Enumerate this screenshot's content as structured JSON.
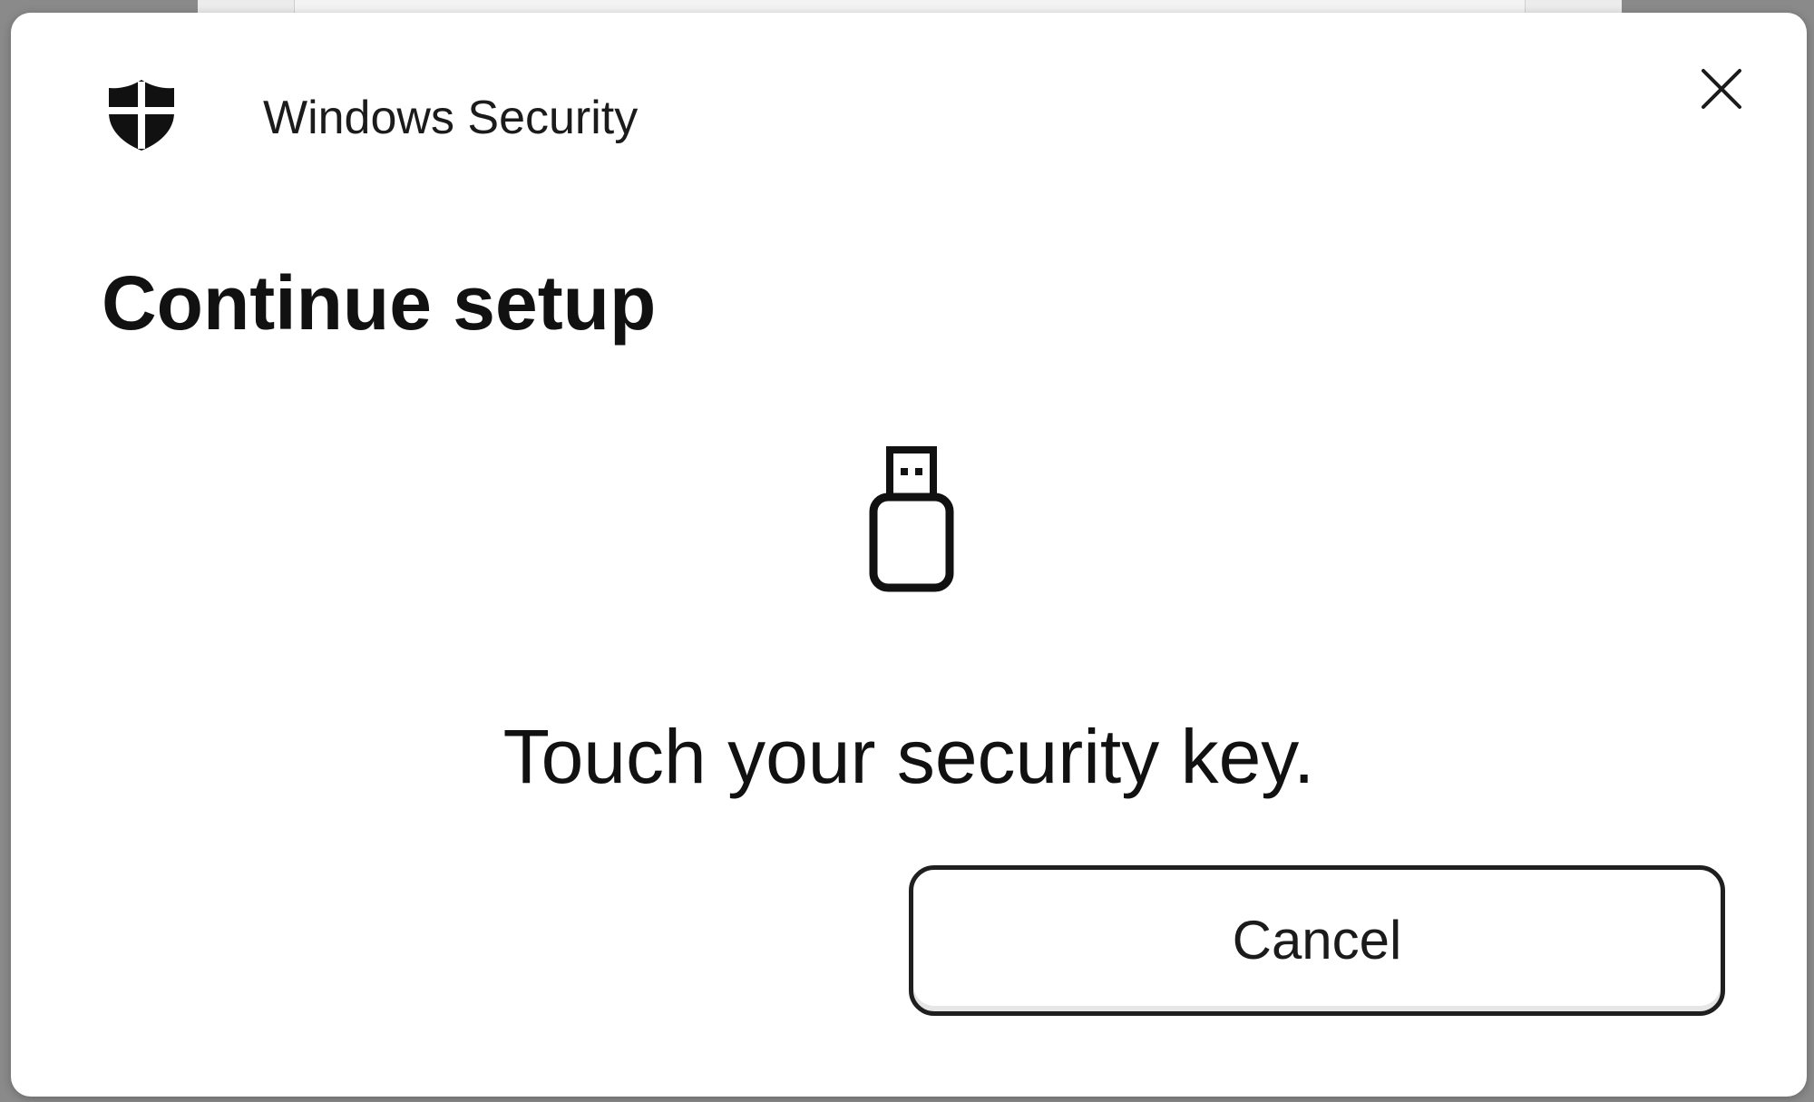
{
  "window": {
    "app_title": "Windows Security",
    "app_icon": "shield-icon",
    "close_icon": "close-icon"
  },
  "content": {
    "heading": "Continue setup",
    "device_icon": "usb-security-key-icon",
    "message": "Touch your security key."
  },
  "actions": {
    "cancel_label": "Cancel"
  },
  "colors": {
    "dialog_background": "#ffffff",
    "text": "#1b1b1b",
    "overlay_background": "#8a8a8a",
    "button_border": "#1f1f1f"
  }
}
